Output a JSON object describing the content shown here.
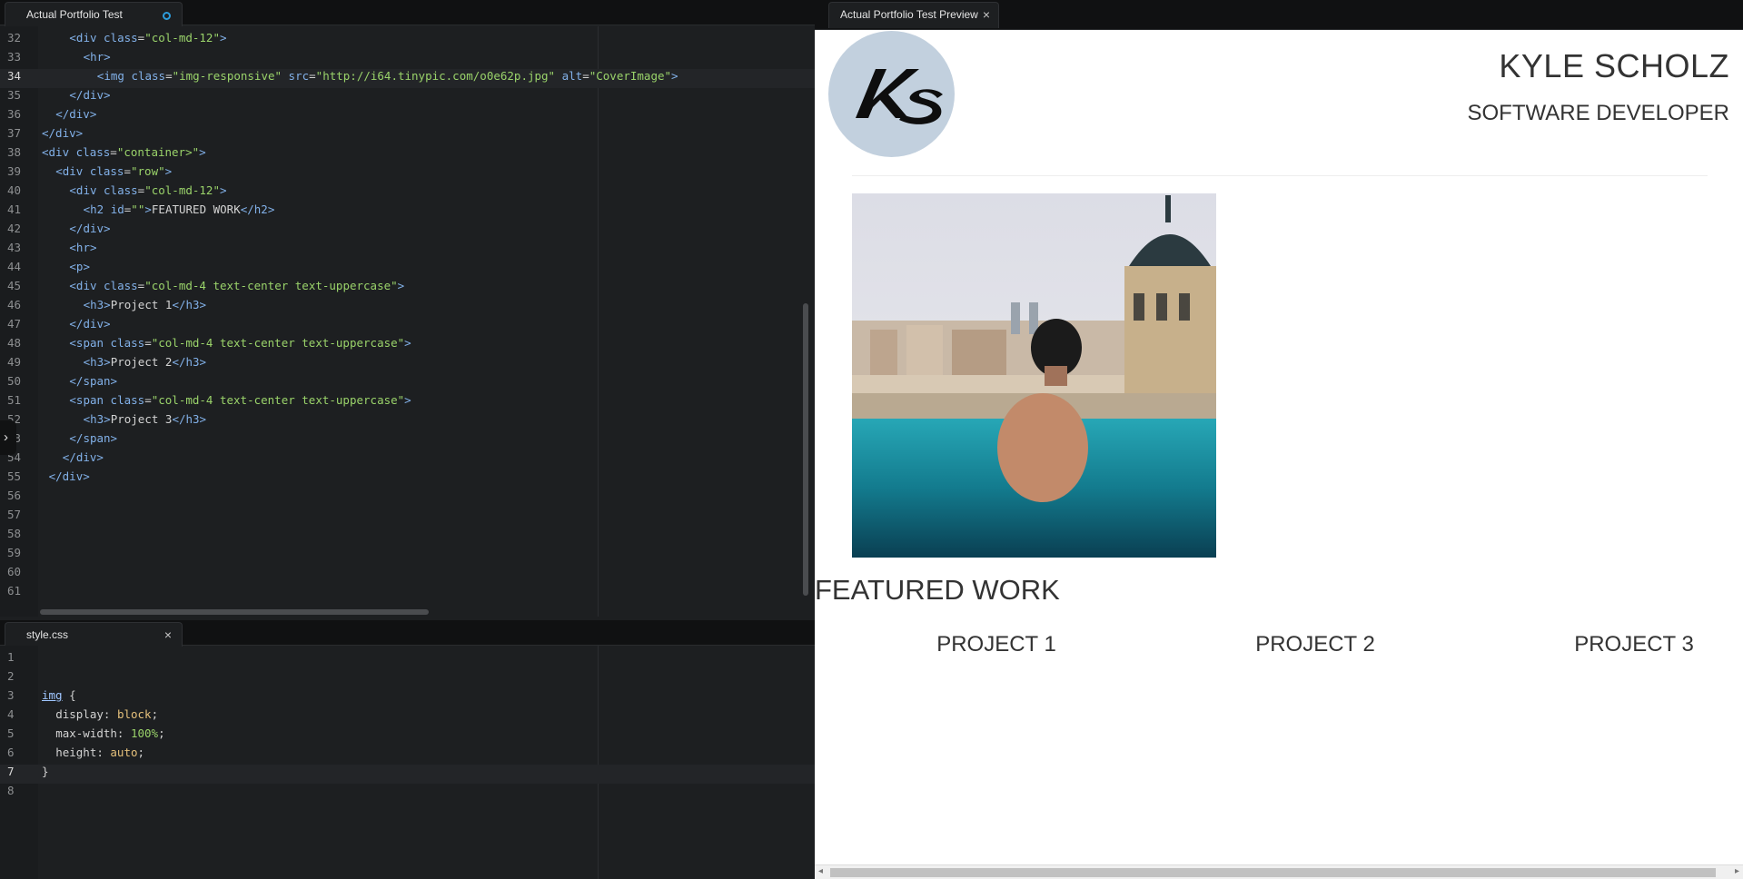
{
  "editor": {
    "tab_title": "Actual Portfolio Test",
    "active_line": "34",
    "lines": [
      {
        "n": "32",
        "indent": 4,
        "tokens": [
          [
            "t-tag",
            "<div "
          ],
          [
            "t-attr",
            "class"
          ],
          [
            "t-punc",
            "="
          ],
          [
            "t-str",
            "\"col-md-12\""
          ],
          [
            "t-tag",
            ">"
          ]
        ]
      },
      {
        "n": "33",
        "indent": 6,
        "tokens": [
          [
            "t-tag",
            "<hr>"
          ]
        ]
      },
      {
        "n": "34",
        "indent": 8,
        "tokens": [
          [
            "t-tag",
            "<img "
          ],
          [
            "t-attr",
            "class"
          ],
          [
            "t-punc",
            "="
          ],
          [
            "t-str",
            "\"img-responsive\""
          ],
          [
            "t-attr",
            " src"
          ],
          [
            "t-punc",
            "="
          ],
          [
            "t-str",
            "\"http://i64.tinypic.com/o0e62p.jpg\""
          ],
          [
            "t-attr",
            " alt"
          ],
          [
            "t-punc",
            "="
          ],
          [
            "t-str",
            "\"CoverImage\""
          ],
          [
            "t-tag",
            ">"
          ]
        ]
      },
      {
        "n": "35",
        "indent": 4,
        "tokens": [
          [
            "t-tag",
            "</div>"
          ]
        ]
      },
      {
        "n": "36",
        "indent": 2,
        "tokens": [
          [
            "t-tag",
            "</div>"
          ]
        ]
      },
      {
        "n": "37",
        "indent": 0,
        "tokens": [
          [
            "t-tag",
            "</div>"
          ]
        ]
      },
      {
        "n": "38",
        "indent": 0,
        "tokens": [
          [
            "t-tag",
            "<div "
          ],
          [
            "t-attr",
            "class"
          ],
          [
            "t-punc",
            "="
          ],
          [
            "t-str",
            "\"container>\""
          ],
          [
            "t-tag",
            ">"
          ]
        ]
      },
      {
        "n": "39",
        "indent": 2,
        "tokens": [
          [
            "t-tag",
            "<div "
          ],
          [
            "t-attr",
            "class"
          ],
          [
            "t-punc",
            "="
          ],
          [
            "t-str",
            "\"row\""
          ],
          [
            "t-tag",
            ">"
          ]
        ]
      },
      {
        "n": "40",
        "indent": 4,
        "tokens": [
          [
            "t-tag",
            "<div "
          ],
          [
            "t-attr",
            "class"
          ],
          [
            "t-punc",
            "="
          ],
          [
            "t-str",
            "\"col-md-12\""
          ],
          [
            "t-tag",
            ">"
          ]
        ]
      },
      {
        "n": "41",
        "indent": 6,
        "tokens": [
          [
            "t-tag",
            "<h2 "
          ],
          [
            "t-attr",
            "id"
          ],
          [
            "t-punc",
            "="
          ],
          [
            "t-str",
            "\"\""
          ],
          [
            "t-tag",
            ">"
          ],
          [
            "t-txt",
            "FEATURED WORK"
          ],
          [
            "t-tag",
            "</h2>"
          ]
        ]
      },
      {
        "n": "42",
        "indent": 4,
        "tokens": [
          [
            "t-tag",
            "</div>"
          ]
        ]
      },
      {
        "n": "43",
        "indent": 4,
        "tokens": [
          [
            "t-tag",
            "<hr>"
          ]
        ]
      },
      {
        "n": "44",
        "indent": 4,
        "tokens": [
          [
            "t-tag",
            "<p>"
          ]
        ]
      },
      {
        "n": "45",
        "indent": 4,
        "tokens": [
          [
            "t-tag",
            "<div "
          ],
          [
            "t-attr",
            "class"
          ],
          [
            "t-punc",
            "="
          ],
          [
            "t-str",
            "\"col-md-4 text-center text-uppercase\""
          ],
          [
            "t-tag",
            ">"
          ]
        ]
      },
      {
        "n": "46",
        "indent": 6,
        "tokens": [
          [
            "t-tag",
            "<h3>"
          ],
          [
            "t-txt",
            "Project 1"
          ],
          [
            "t-tag",
            "</h3>"
          ]
        ]
      },
      {
        "n": "47",
        "indent": 4,
        "tokens": [
          [
            "t-tag",
            "</div>"
          ]
        ]
      },
      {
        "n": "48",
        "indent": 4,
        "tokens": [
          [
            "t-tag",
            "<span "
          ],
          [
            "t-attr",
            "class"
          ],
          [
            "t-punc",
            "="
          ],
          [
            "t-str",
            "\"col-md-4 text-center text-uppercase\""
          ],
          [
            "t-tag",
            ">"
          ]
        ]
      },
      {
        "n": "49",
        "indent": 6,
        "tokens": [
          [
            "t-tag",
            "<h3>"
          ],
          [
            "t-txt",
            "Project 2"
          ],
          [
            "t-tag",
            "</h3>"
          ]
        ]
      },
      {
        "n": "50",
        "indent": 4,
        "tokens": [
          [
            "t-tag",
            "</span>"
          ]
        ]
      },
      {
        "n": "51",
        "indent": 4,
        "tokens": [
          [
            "t-tag",
            "<span "
          ],
          [
            "t-attr",
            "class"
          ],
          [
            "t-punc",
            "="
          ],
          [
            "t-str",
            "\"col-md-4 text-center text-uppercase\""
          ],
          [
            "t-tag",
            ">"
          ]
        ]
      },
      {
        "n": "52",
        "indent": 6,
        "tokens": [
          [
            "t-tag",
            "<h3>"
          ],
          [
            "t-txt",
            "Project 3"
          ],
          [
            "t-tag",
            "</h3>"
          ]
        ]
      },
      {
        "n": "53",
        "indent": 4,
        "tokens": [
          [
            "t-tag",
            "</span>"
          ]
        ]
      },
      {
        "n": "54",
        "indent": 3,
        "tokens": [
          [
            "t-tag",
            "</div>"
          ]
        ]
      },
      {
        "n": "55",
        "indent": 1,
        "tokens": [
          [
            "t-tag",
            "</div>"
          ]
        ]
      },
      {
        "n": "56",
        "indent": 0,
        "tokens": []
      },
      {
        "n": "57",
        "indent": 0,
        "tokens": []
      },
      {
        "n": "58",
        "indent": 0,
        "tokens": []
      },
      {
        "n": "59",
        "indent": 0,
        "tokens": []
      },
      {
        "n": "60",
        "indent": 0,
        "tokens": []
      },
      {
        "n": "61",
        "indent": 0,
        "tokens": []
      }
    ]
  },
  "css_editor": {
    "tab_title": "style.css",
    "active_line": "7",
    "lines": [
      {
        "n": "1",
        "indent": 0,
        "tokens": []
      },
      {
        "n": "2",
        "indent": 0,
        "tokens": []
      },
      {
        "n": "3",
        "indent": 0,
        "tokens": [
          [
            "t-sel",
            "img"
          ],
          [
            "t-punc",
            " {"
          ]
        ]
      },
      {
        "n": "4",
        "indent": 2,
        "tokens": [
          [
            "t-prop",
            "display"
          ],
          [
            "t-punc",
            ": "
          ],
          [
            "t-val",
            "block"
          ],
          [
            "t-punc",
            ";"
          ]
        ]
      },
      {
        "n": "5",
        "indent": 2,
        "tokens": [
          [
            "t-prop",
            "max-width"
          ],
          [
            "t-punc",
            ": "
          ],
          [
            "t-num",
            "100%"
          ],
          [
            "t-punc",
            ";"
          ]
        ]
      },
      {
        "n": "6",
        "indent": 2,
        "tokens": [
          [
            "t-prop",
            "height"
          ],
          [
            "t-punc",
            ": "
          ],
          [
            "t-val",
            "auto"
          ],
          [
            "t-punc",
            ";"
          ]
        ]
      },
      {
        "n": "7",
        "indent": 0,
        "tokens": [
          [
            "t-punc",
            "}"
          ]
        ]
      },
      {
        "n": "8",
        "indent": 0,
        "tokens": []
      }
    ]
  },
  "preview": {
    "tab_title": "Actual Portfolio Test Preview",
    "name": "KYLE SCHOLZ",
    "role": "SOFTWARE DEVELOPER",
    "featured_heading": "FEATURED WORK",
    "projects": [
      "Project 1",
      "Project 2",
      "Project 3"
    ]
  },
  "icons": {
    "close": "×",
    "expand": "›",
    "scroll_left": "◂",
    "scroll_right": "▸"
  }
}
